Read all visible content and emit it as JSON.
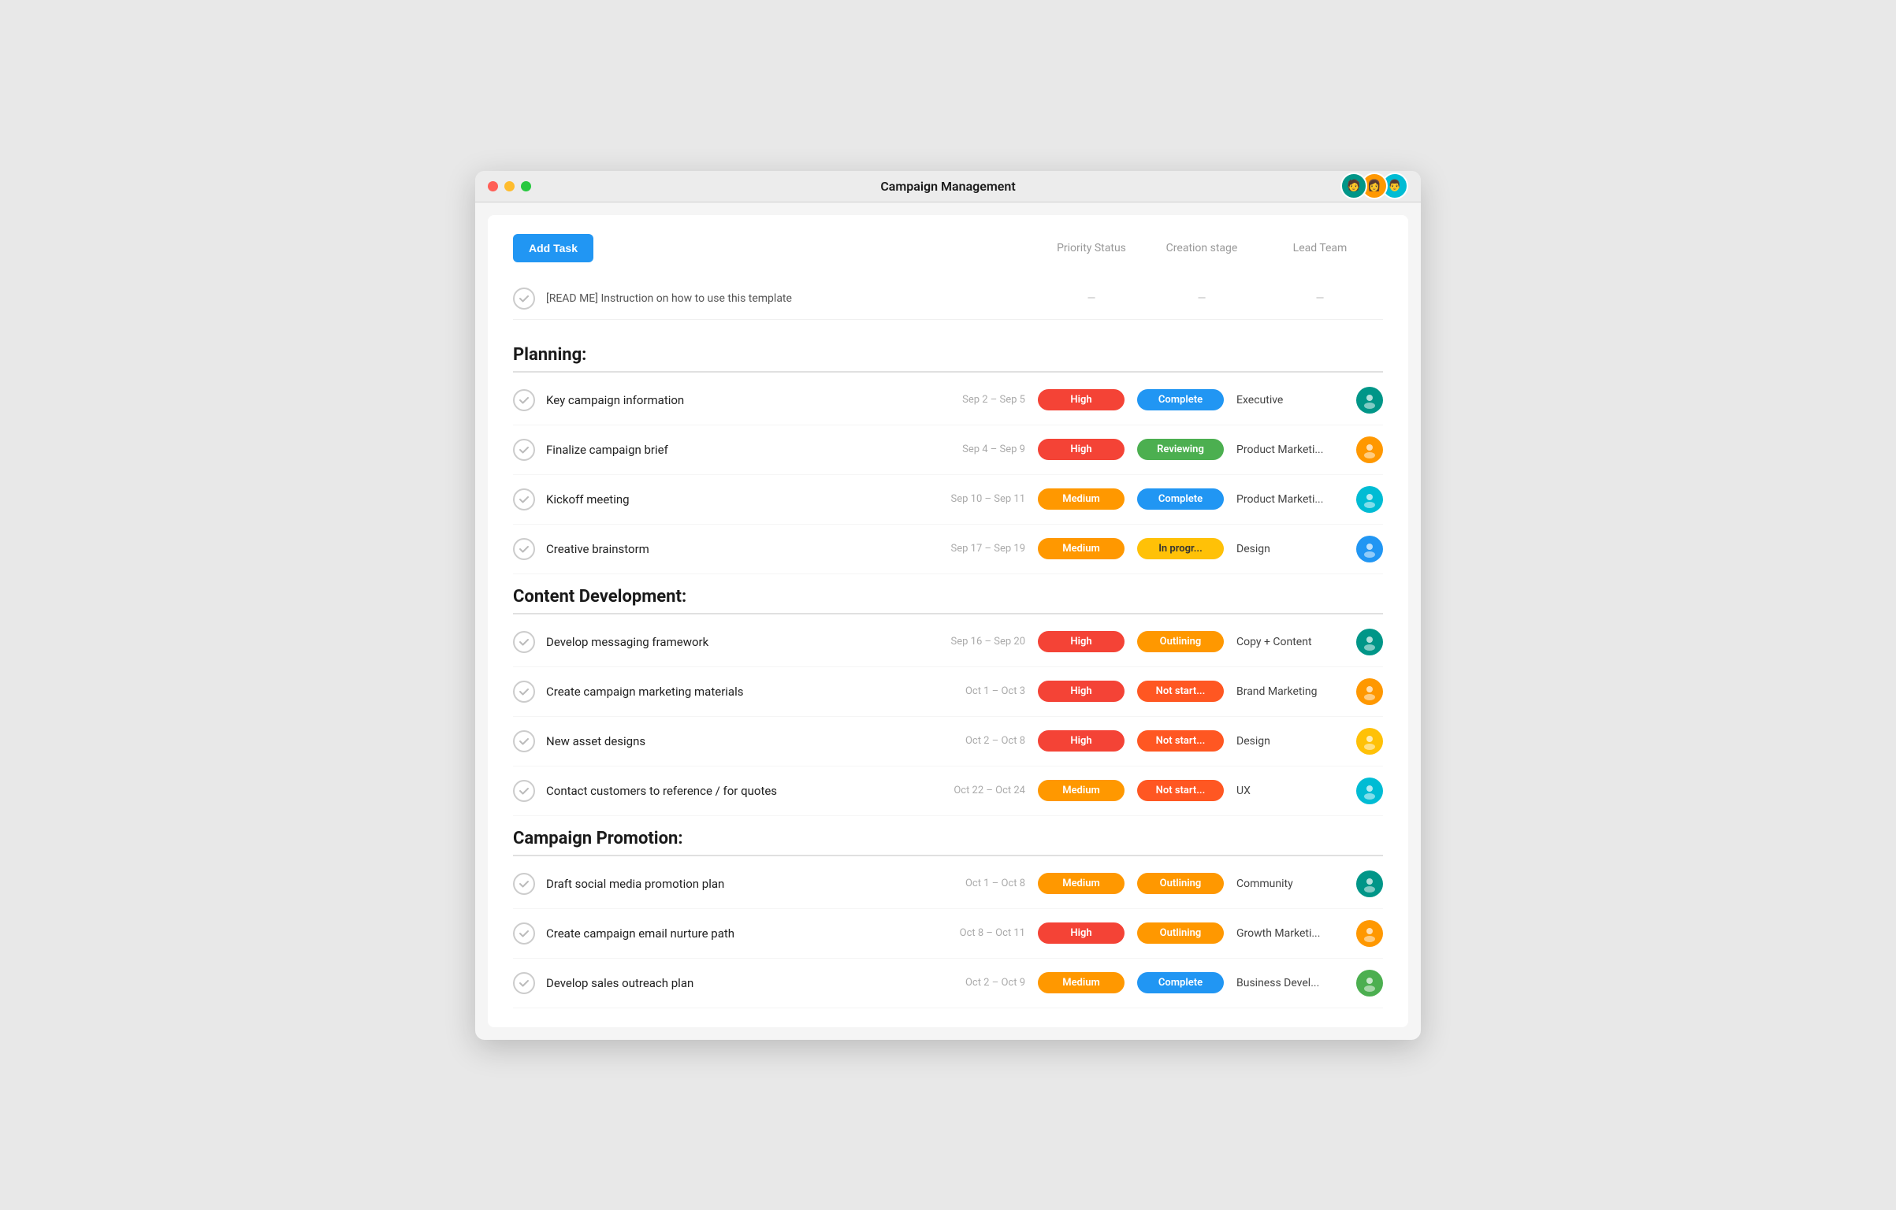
{
  "window": {
    "title": "Campaign Management"
  },
  "toolbar": {
    "add_task_label": "Add Task",
    "col_priority": "Priority Status",
    "col_stage": "Creation stage",
    "col_team": "Lead Team"
  },
  "instruction_row": {
    "text": "[READ ME] Instruction on how to use this template",
    "dashes": [
      "—",
      "—",
      "—"
    ]
  },
  "sections": [
    {
      "id": "planning",
      "label": "Planning:",
      "tasks": [
        {
          "name": "Key campaign information",
          "dates": "Sep 2 – Sep 5",
          "priority": "High",
          "priority_class": "priority-high",
          "status": "Complete",
          "status_class": "status-complete",
          "team": "Executive",
          "avatar_class": "av-teal",
          "avatar_emoji": "👤"
        },
        {
          "name": "Finalize campaign brief",
          "dates": "Sep 4 – Sep 9",
          "priority": "High",
          "priority_class": "priority-high",
          "status": "Reviewing",
          "status_class": "status-reviewing",
          "team": "Product Marketi...",
          "avatar_class": "av-orange",
          "avatar_emoji": "👤"
        },
        {
          "name": "Kickoff meeting",
          "dates": "Sep 10 – Sep 11",
          "priority": "Medium",
          "priority_class": "priority-medium",
          "status": "Complete",
          "status_class": "status-complete",
          "team": "Product Marketi...",
          "avatar_class": "av-cyan",
          "avatar_emoji": "👤"
        },
        {
          "name": "Creative brainstorm",
          "dates": "Sep 17 – Sep 19",
          "priority": "Medium",
          "priority_class": "priority-medium",
          "status": "In progr...",
          "status_class": "status-inprogress",
          "team": "Design",
          "avatar_class": "av-blue",
          "avatar_emoji": "👤"
        }
      ]
    },
    {
      "id": "content-development",
      "label": "Content Development:",
      "tasks": [
        {
          "name": "Develop messaging framework",
          "dates": "Sep 16 – Sep 20",
          "priority": "High",
          "priority_class": "priority-high",
          "status": "Outlining",
          "status_class": "status-outlining",
          "team": "Copy + Content",
          "avatar_class": "av-teal",
          "avatar_emoji": "👤"
        },
        {
          "name": "Create campaign marketing materials",
          "dates": "Oct 1 – Oct 3",
          "priority": "High",
          "priority_class": "priority-high",
          "status": "Not start...",
          "status_class": "status-notstart",
          "team": "Brand Marketing",
          "avatar_class": "av-orange",
          "avatar_emoji": "👤"
        },
        {
          "name": "New asset designs",
          "dates": "Oct 2 – Oct 8",
          "priority": "High",
          "priority_class": "priority-high",
          "status": "Not start...",
          "status_class": "status-notstart",
          "team": "Design",
          "avatar_class": "av-yellow",
          "avatar_emoji": "👤"
        },
        {
          "name": "Contact customers to reference / for quotes",
          "dates": "Oct 22 – Oct 24",
          "priority": "Medium",
          "priority_class": "priority-medium",
          "status": "Not start...",
          "status_class": "status-notstart",
          "team": "UX",
          "avatar_class": "av-cyan",
          "avatar_emoji": "👤"
        }
      ]
    },
    {
      "id": "campaign-promotion",
      "label": "Campaign Promotion:",
      "tasks": [
        {
          "name": "Draft social media promotion plan",
          "dates": "Oct 1 – Oct 8",
          "priority": "Medium",
          "priority_class": "priority-medium",
          "status": "Outlining",
          "status_class": "status-outlining",
          "team": "Community",
          "avatar_class": "av-teal",
          "avatar_emoji": "👤"
        },
        {
          "name": "Create campaign email nurture path",
          "dates": "Oct 8 – Oct 11",
          "priority": "High",
          "priority_class": "priority-high",
          "status": "Outlining",
          "status_class": "status-outlining",
          "team": "Growth Marketi...",
          "avatar_class": "av-orange",
          "avatar_emoji": "👤"
        },
        {
          "name": "Develop sales outreach plan",
          "dates": "Oct 2 – Oct 9",
          "priority": "Medium",
          "priority_class": "priority-medium",
          "status": "Complete",
          "status_class": "status-complete",
          "team": "Business Devel...",
          "avatar_class": "av-green",
          "avatar_emoji": "👤"
        }
      ]
    }
  ],
  "top_avatars": [
    {
      "class": "av-teal",
      "emoji": "👤"
    },
    {
      "class": "av-orange",
      "emoji": "👤"
    },
    {
      "class": "av-cyan",
      "emoji": "👤"
    }
  ]
}
